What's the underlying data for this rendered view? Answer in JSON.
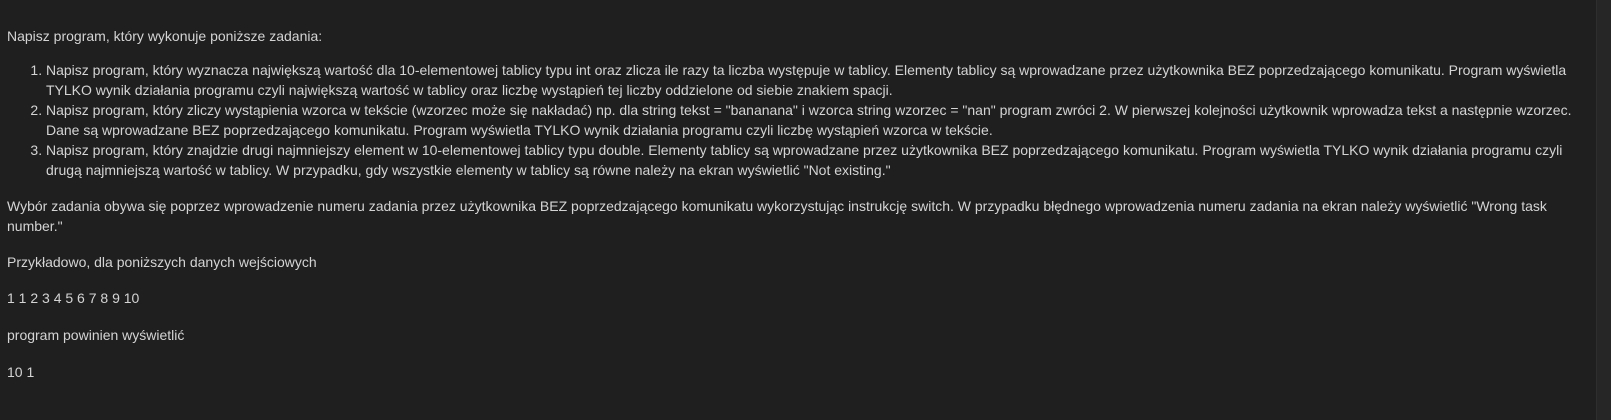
{
  "intro": "Napisz program, który wykonuje poniższe zadania:",
  "tasks": [
    "Napisz program, który wyznacza największą wartość dla 10-elementowej tablicy typu int oraz zlicza ile razy ta liczba występuje w tablicy. Elementy tablicy są wprowadzane przez użytkownika BEZ poprzedzającego komunikatu. Program wyświetla TYLKO wynik działania programu czyli największą wartość w tablicy oraz liczbę wystąpień tej liczby oddzielone od siebie znakiem spacji.",
    "Napisz program, który zliczy wystąpienia wzorca w tekście (wzorzec może się nakładać) np. dla string tekst = \"bananana\" i wzorca string wzorzec = \"nan\" program zwróci 2. W pierwszej kolejności użytkownik wprowadza tekst a następnie wzorzec. Dane są wprowadzane  BEZ poprzedzającego komunikatu. Program wyświetla TYLKO wynik działania programu czyli liczbę wystąpień wzorca w tekście.",
    "Napisz program, który znajdzie drugi najmniejszy element w 10-elementowej tablicy typu double. Elementy tablicy są wprowadzane przez użytkownika BEZ poprzedzającego komunikatu. Program wyświetla TYLKO wynik działania programu czyli drugą najmniejszą wartość w tablicy. W przypadku, gdy wszystkie elementy w tablicy są równe należy na ekran wyświetlić \"Not existing.\""
  ],
  "switch_info": "Wybór zadania obywa się poprzez wprowadzenie numeru zadania przez użytkownika BEZ poprzedzającego komunikatu wykorzystując instrukcję switch. W przypadku błędnego wprowadzenia numeru zadania na ekran należy wyświetlić \"Wrong task number.\"",
  "example_intro": "Przykładowo, dla poniższych danych wejściowych",
  "example_input": "1 1 2 3 4 5 6 7 8 9 10",
  "expected_intro": "program powinien wyświetlić",
  "expected_output": "10 1",
  "colors": {
    "background": "#1f1f1f",
    "text": "#d4d4d4"
  }
}
